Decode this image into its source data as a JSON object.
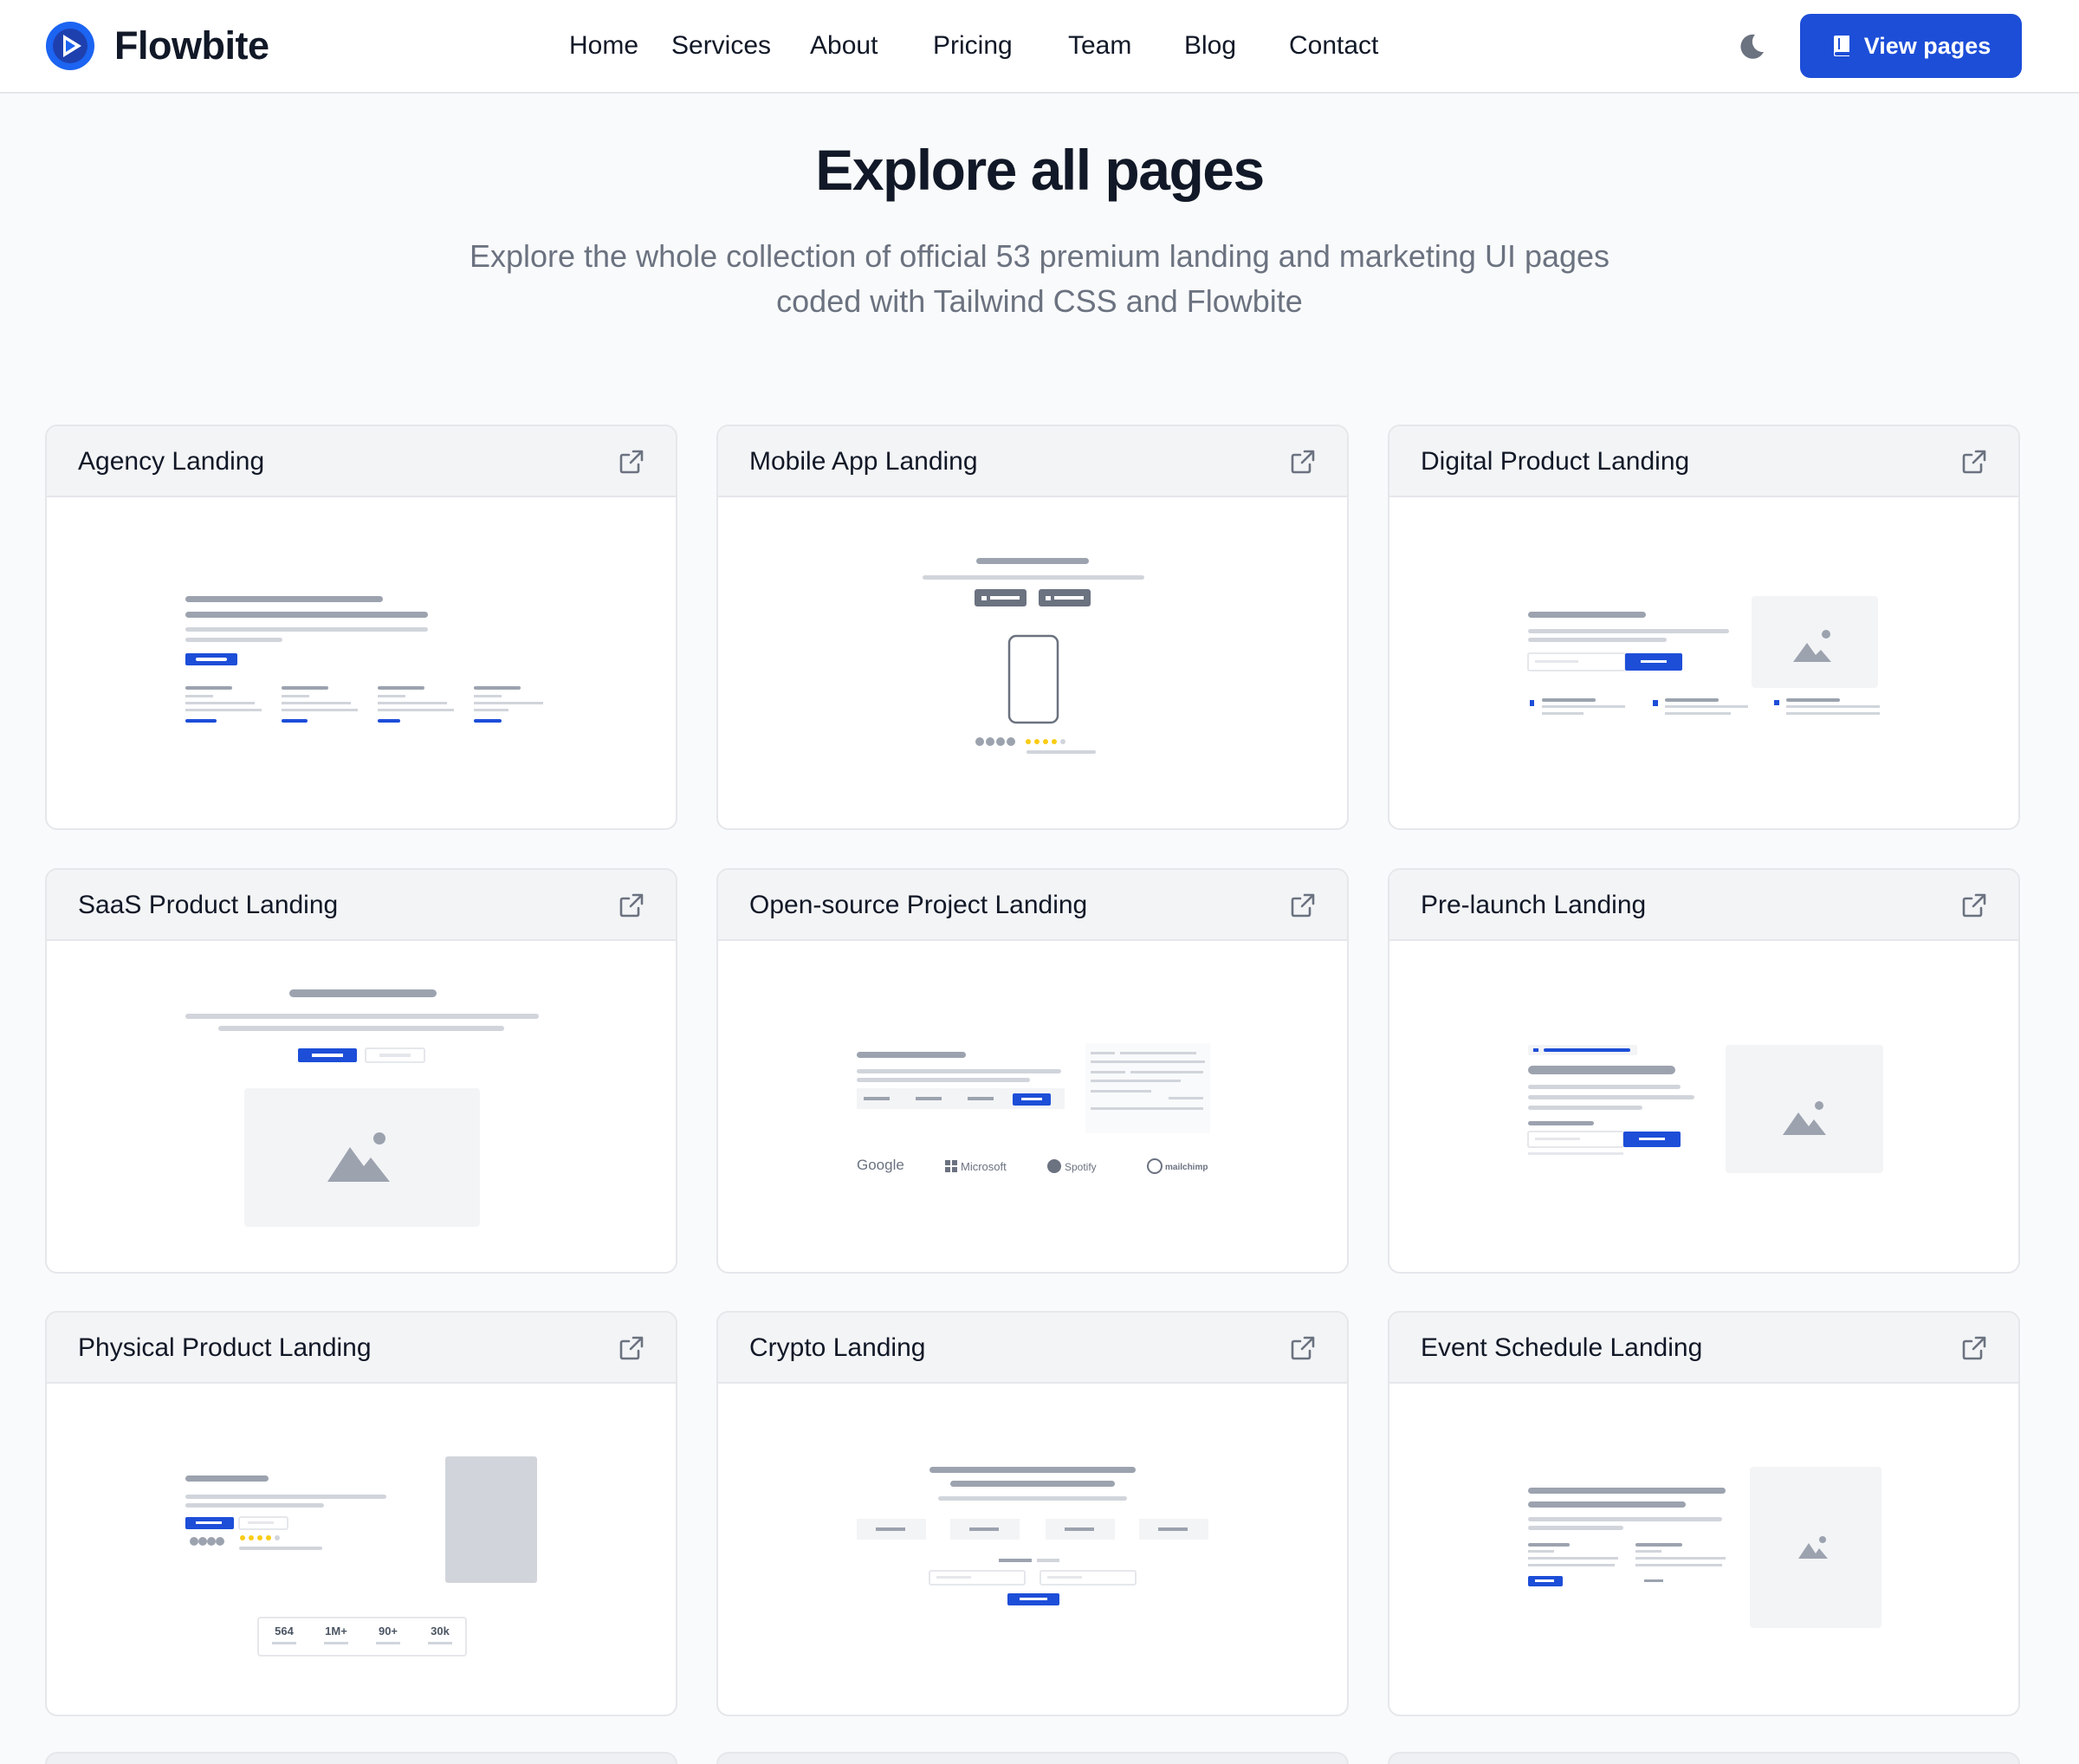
{
  "brand": {
    "name": "Flowbite",
    "accent": "#1d4ed8"
  },
  "nav": {
    "links": [
      "Home",
      "Services",
      "About",
      "Pricing",
      "Team",
      "Blog",
      "Contact"
    ],
    "theme_toggle_icon": "moon-icon",
    "cta_label": "View pages",
    "cta_icon": "book-icon"
  },
  "hero": {
    "title": "Explore all pages",
    "subtitle": "Explore the whole collection of official 53 premium landing and marketing UI pages coded with Tailwind CSS and Flowbite"
  },
  "cards": [
    {
      "title": "Agency Landing",
      "icon": "external-link-icon"
    },
    {
      "title": "Mobile App Landing",
      "icon": "external-link-icon"
    },
    {
      "title": "Digital Product Landing",
      "icon": "external-link-icon"
    },
    {
      "title": "SaaS Product Landing",
      "icon": "external-link-icon"
    },
    {
      "title": "Open-source Project Landing",
      "icon": "external-link-icon"
    },
    {
      "title": "Pre-launch Landing",
      "icon": "external-link-icon"
    },
    {
      "title": "Physical Product Landing",
      "icon": "external-link-icon"
    },
    {
      "title": "Crypto Landing",
      "icon": "external-link-icon"
    },
    {
      "title": "Event Schedule Landing",
      "icon": "external-link-icon"
    }
  ],
  "previews": {
    "open_source_logos": [
      "Google",
      "Microsoft",
      "Spotify",
      "mailchimp"
    ],
    "physical_product_stats": [
      "564",
      "1M+",
      "90+",
      "30k"
    ]
  }
}
